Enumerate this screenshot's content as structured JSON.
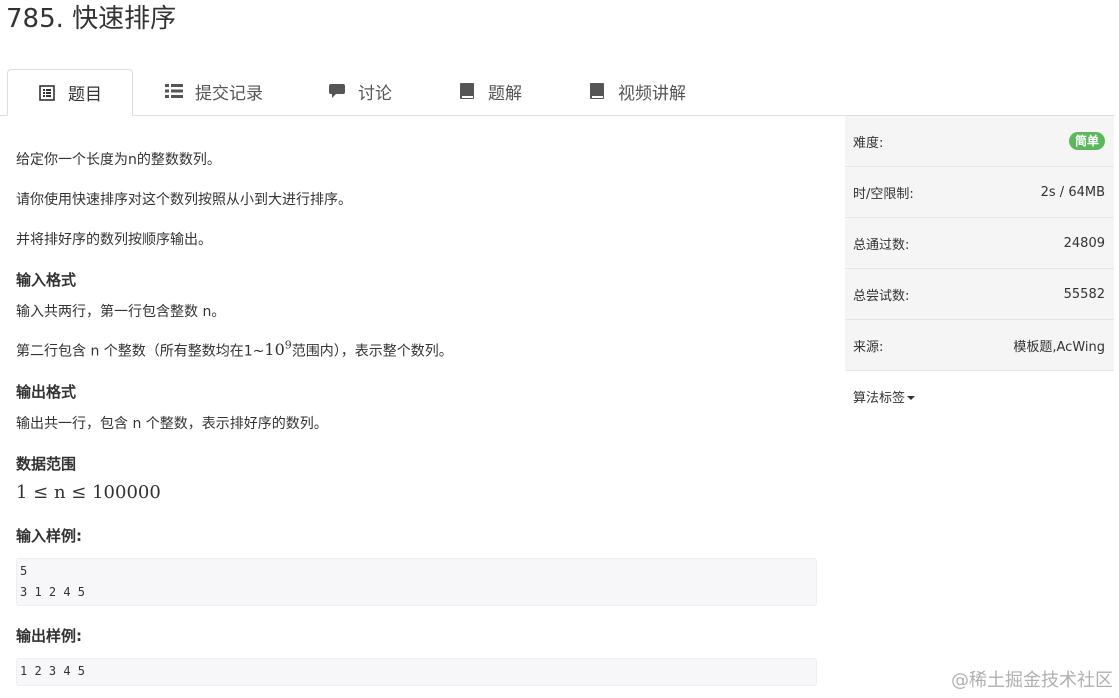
{
  "title": "785. 快速排序",
  "tabs": [
    {
      "label": "题目",
      "icon": "list-alt-icon"
    },
    {
      "label": "提交记录",
      "icon": "list-icon"
    },
    {
      "label": "讨论",
      "icon": "comment-icon"
    },
    {
      "label": "题解",
      "icon": "book-icon"
    },
    {
      "label": "视频讲解",
      "icon": "book-icon"
    }
  ],
  "problem": {
    "para1": "给定你一个长度为n的整数数列。",
    "para2": "请你使用快速排序对这个数列按照从小到大进行排序。",
    "para3": "并将排好序的数列按顺序输出。",
    "input_format_heading": "输入格式",
    "input_line1": "输入共两行，第一行包含整数 n。",
    "input_line2_pre": "第二行包含 n 个整数（所有整数均在1~",
    "input_line2_math_base": "10",
    "input_line2_math_exp": "9",
    "input_line2_post": "范围内），表示整个数列。",
    "output_format_heading": "输出格式",
    "output_line1": "输出共一行，包含 n 个整数，表示排好序的数列。",
    "range_heading": "数据范围",
    "range_math": "1 ≤ n ≤ 100000",
    "sample_input_heading": "输入样例:",
    "sample_input_lines": [
      "5",
      "3 1 2 4 5"
    ],
    "sample_output_heading": "输出样例:",
    "sample_output_lines": [
      "1 2 3 4 5"
    ]
  },
  "sidebar": {
    "difficulty_label": "难度:",
    "difficulty_value": "简单",
    "limit_label": "时/空限制:",
    "limit_value": "2s / 64MB",
    "passed_label": "总通过数:",
    "passed_value": "24809",
    "tried_label": "总尝试数:",
    "tried_value": "55582",
    "source_label": "来源:",
    "source_value": "模板题,AcWing",
    "tags_label": "算法标签"
  },
  "colors": {
    "badge_green": "#5cb85c",
    "sidebar_bg": "#f5f5f5",
    "code_bg": "#f7f7f9"
  },
  "watermark": "@稀土掘金技术社区"
}
